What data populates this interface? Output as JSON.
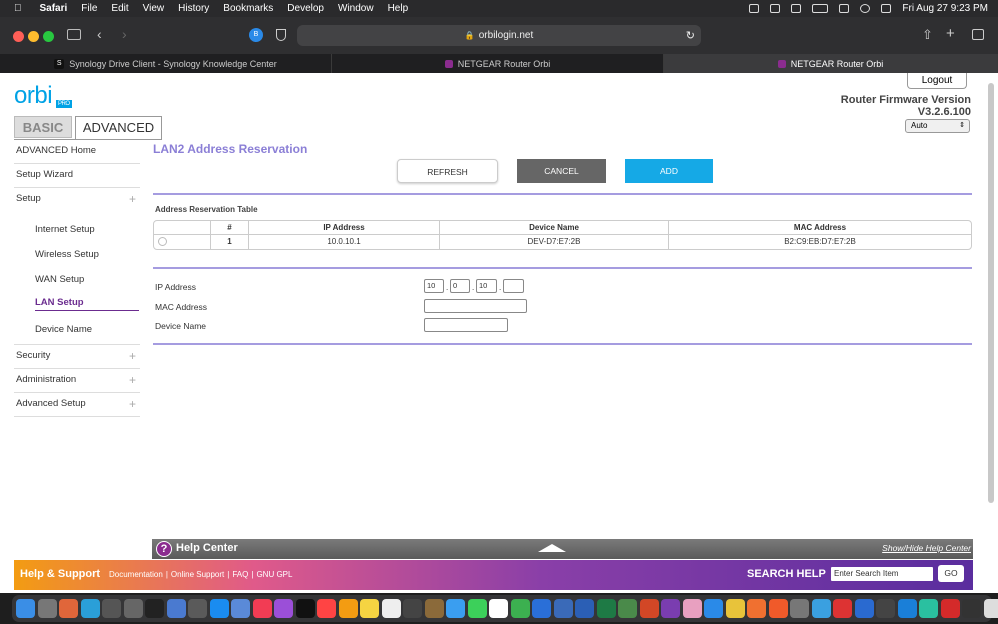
{
  "menubar": {
    "app": "Safari",
    "items": [
      "File",
      "Edit",
      "View",
      "History",
      "Bookmarks",
      "Develop",
      "Window",
      "Help"
    ],
    "clock": "Fri Aug 27  9:23 PM"
  },
  "browser": {
    "url": "orbilogin.net",
    "tabs": [
      "Synology Drive Client - Synology Knowledge Center",
      "NETGEAR Router Orbi",
      "NETGEAR Router Orbi"
    ],
    "active_tab": 2
  },
  "header": {
    "logo": "orbi",
    "logo_badge": "PRO",
    "logout": "Logout",
    "firmware_label": "Router Firmware Version",
    "firmware_version": "V3.2.6.100",
    "language": "Auto",
    "tab_basic": "BASIC",
    "tab_advanced": "ADVANCED"
  },
  "sidebar": {
    "home": "ADVANCED Home",
    "wizard": "Setup Wizard",
    "setup": "Setup",
    "setup_items": [
      "Internet Setup",
      "Wireless Setup",
      "WAN Setup",
      "LAN Setup",
      "Device Name"
    ],
    "active_item": "LAN Setup",
    "security": "Security",
    "administration": "Administration",
    "advanced_setup": "Advanced Setup",
    "plus": "+"
  },
  "main": {
    "title": "LAN2 Address Reservation",
    "refresh": "REFRESH",
    "cancel": "CANCEL",
    "add": "ADD",
    "table_title": "Address Reservation Table",
    "columns": [
      "#",
      "IP Address",
      "Device Name",
      "MAC Address"
    ],
    "rows": [
      {
        "num": "1",
        "ip": "10.0.10.1",
        "device": "DEV-D7:E7:2B",
        "mac": "B2:C9:EB:D7:E7:2B"
      }
    ],
    "form": {
      "ip_label": "IP Address",
      "ip_octets": [
        "10",
        "0",
        "10",
        ""
      ],
      "mac_label": "MAC Address",
      "device_label": "Device Name"
    }
  },
  "footer": {
    "help_center": "Help Center",
    "show_hide": "Show/Hide Help Center",
    "support": "Help & Support",
    "links": [
      "Documentation",
      "|",
      "Online Support",
      "|",
      "FAQ",
      "|",
      "GNU GPL"
    ],
    "search_help": "SEARCH HELP",
    "search_placeholder": "Enter Search Item",
    "go": "GO"
  },
  "colors": {
    "accent": "#8b7fd6",
    "add": "#15a9e6",
    "cancel": "#666666",
    "brand": "#00a2e5"
  },
  "dock_icons": [
    "finder",
    "launchpad",
    "safari",
    "mail",
    "calendar",
    "notes",
    "photos",
    "music",
    "podcasts",
    "tv",
    "appstore",
    "settings",
    "chrome",
    "firefox",
    "word",
    "excel",
    "powerpoint",
    "onenote",
    "trash"
  ]
}
